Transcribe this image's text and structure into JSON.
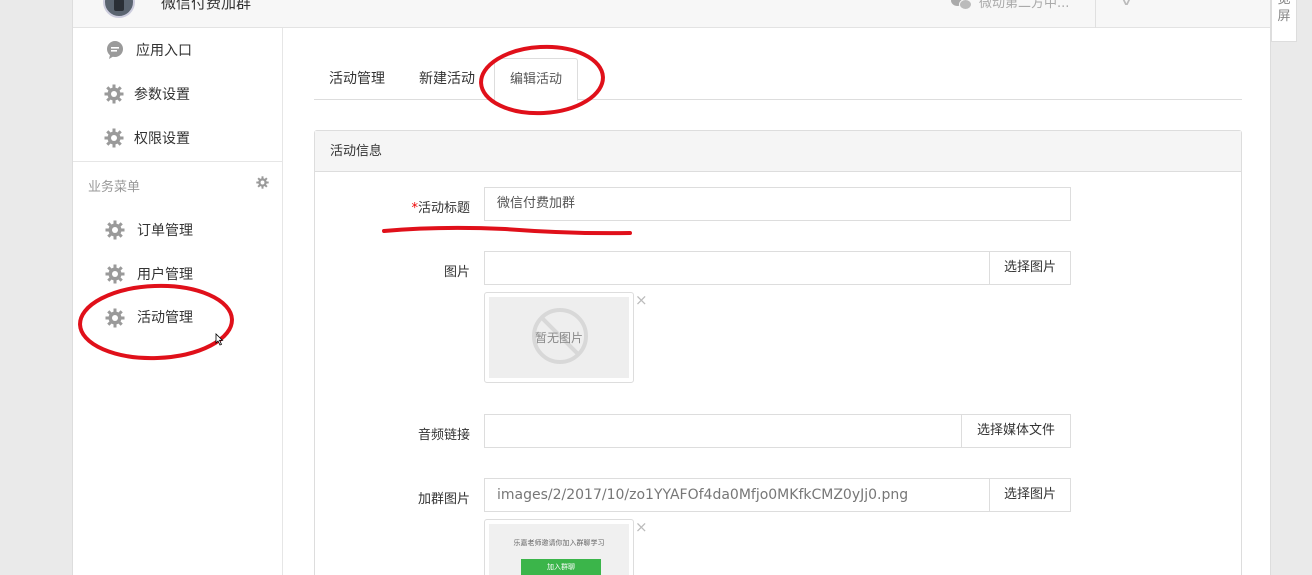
{
  "header": {
    "app_title": "微信付费加群",
    "account_name": "微动第二方中..."
  },
  "float_tab": {
    "label": "宽屏"
  },
  "sidebar": {
    "items_top": [
      {
        "label": "应用入口",
        "icon": "chat-bubble-icon"
      },
      {
        "label": "参数设置",
        "icon": "gear-icon"
      },
      {
        "label": "权限设置",
        "icon": "gear-icon"
      }
    ],
    "section_title": "业务菜单",
    "items_business": [
      {
        "label": "订单管理",
        "icon": "gear-icon"
      },
      {
        "label": "用户管理",
        "icon": "gear-icon"
      },
      {
        "label": "活动管理",
        "icon": "gear-icon"
      }
    ]
  },
  "tabs": [
    {
      "label": "活动管理"
    },
    {
      "label": "新建活动"
    },
    {
      "label": "编辑活动",
      "active": true
    }
  ],
  "form": {
    "panel_title": "活动信息",
    "title_field": {
      "required_mark": "*",
      "label": "活动标题",
      "value": "微信付费加群"
    },
    "image_field": {
      "label": "图片",
      "value": "",
      "button": "选择图片",
      "placeholder_text": "暂无图片",
      "remove": "×"
    },
    "audio_field": {
      "label": "音频链接",
      "value": "",
      "button": "选择媒体文件"
    },
    "group_image_field": {
      "label": "加群图片",
      "value": "images/2/2017/10/zo1YYAFOf4da0Mfjo0MKfkCMZ0yJj0.png",
      "button": "选择图片",
      "remove": "×",
      "preview_caption": "乐嘉老师邀请你加入群聊学习",
      "preview_button": "加入群聊"
    }
  },
  "colors": {
    "annotation": "#e0101a",
    "accent_green": "#3bb54a"
  }
}
